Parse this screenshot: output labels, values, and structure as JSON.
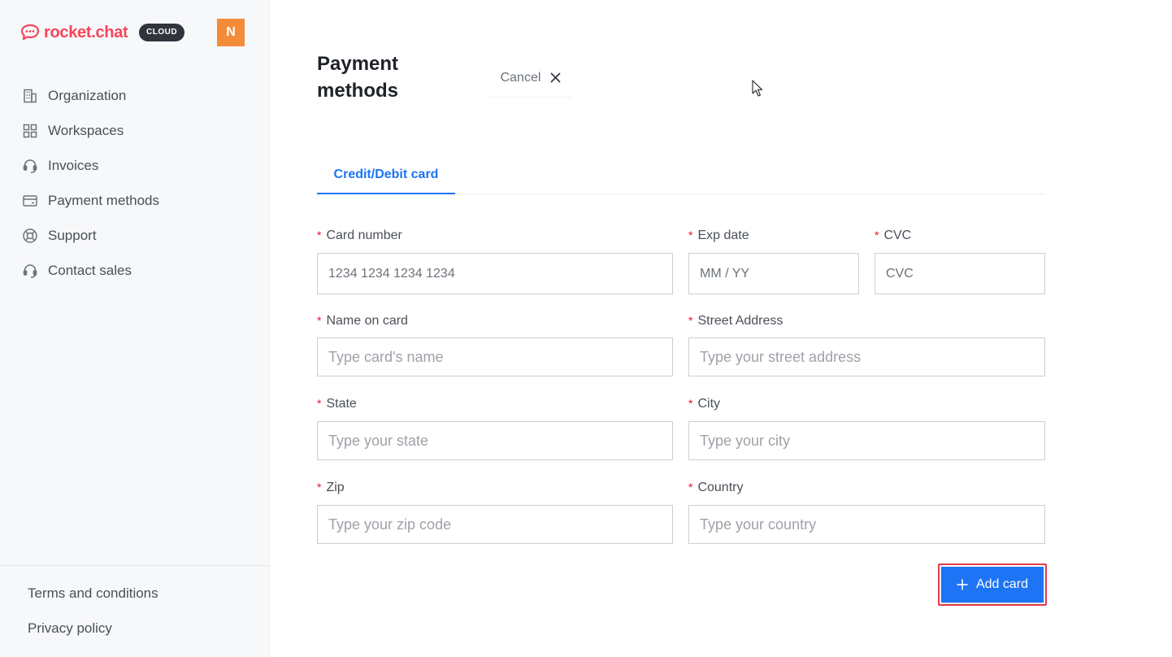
{
  "brand": {
    "name": "rocket.chat",
    "badge": "CLOUD",
    "color": "#f5455c"
  },
  "user": {
    "avatar_initial": "N",
    "avatar_color": "#f38c39"
  },
  "sidebar": {
    "items": [
      {
        "label": "Organization",
        "icon": "building-icon"
      },
      {
        "label": "Workspaces",
        "icon": "grid-icon"
      },
      {
        "label": "Invoices",
        "icon": "headset-icon"
      },
      {
        "label": "Payment methods",
        "icon": "credit-card-icon"
      },
      {
        "label": "Support",
        "icon": "lifebuoy-icon"
      },
      {
        "label": "Contact sales",
        "icon": "headset-icon"
      }
    ],
    "footer": [
      {
        "label": "Terms and conditions"
      },
      {
        "label": "Privacy policy"
      }
    ]
  },
  "main": {
    "title": "Payment methods",
    "cancel_label": "Cancel",
    "tabs": [
      {
        "label": "Credit/Debit card",
        "active": true
      }
    ],
    "form": {
      "card_number": {
        "label": "Card number",
        "placeholder": "1234 1234 1234 1234"
      },
      "exp_date": {
        "label": "Exp date",
        "placeholder": "MM / YY"
      },
      "cvc": {
        "label": "CVC",
        "placeholder": "CVC"
      },
      "name_on_card": {
        "label": "Name on card",
        "placeholder": "Type card's name"
      },
      "street_address": {
        "label": "Street Address",
        "placeholder": "Type your street address"
      },
      "state": {
        "label": "State",
        "placeholder": "Type your state"
      },
      "city": {
        "label": "City",
        "placeholder": "Type your city"
      },
      "zip": {
        "label": "Zip",
        "placeholder": "Type your zip code"
      },
      "country": {
        "label": "Country",
        "placeholder": "Type your country"
      },
      "required_marker": "*"
    },
    "add_card_label": "Add card",
    "accent_color": "#1d74f5"
  }
}
